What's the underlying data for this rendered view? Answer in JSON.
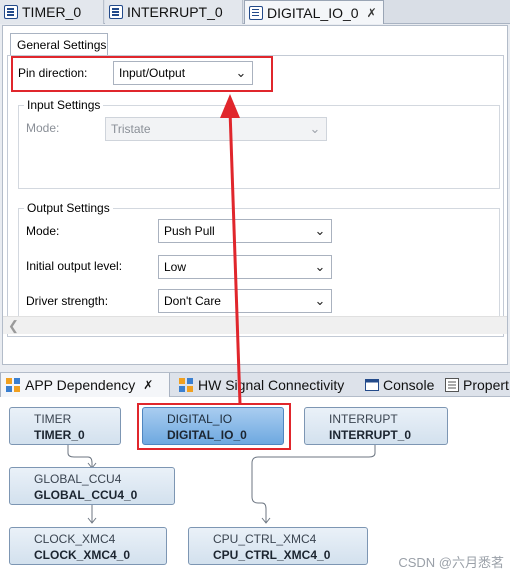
{
  "editor_tabs": [
    {
      "label": "TIMER_0"
    },
    {
      "label": "INTERRUPT_0"
    },
    {
      "label": "DIGITAL_IO_0",
      "close": "✗"
    }
  ],
  "general_settings_tab": "General Settings",
  "pin_direction": {
    "label": "Pin direction:",
    "value": "Input/Output"
  },
  "input_settings": {
    "title": "Input Settings",
    "mode_label": "Mode:",
    "mode_value": "Tristate"
  },
  "output_settings": {
    "title": "Output Settings",
    "mode_label": "Mode:",
    "mode_value": "Push Pull",
    "initial_level_label": "Initial output level:",
    "initial_level_value": "Low",
    "driver_strength_label": "Driver strength:",
    "driver_strength_value": "Don't Care"
  },
  "panel_tabs": [
    {
      "label": "APP Dependency",
      "close": "✗",
      "icon": "app-dependency-icon"
    },
    {
      "label": "HW Signal Connectivity",
      "icon": "hw-signal-icon"
    },
    {
      "label": "Console",
      "icon": "console-icon"
    },
    {
      "label": "Propert",
      "icon": "properties-icon"
    }
  ],
  "nodes": {
    "timer": {
      "type": "TIMER",
      "instance": "TIMER_0"
    },
    "digital_io": {
      "type": "DIGITAL_IO",
      "instance": "DIGITAL_IO_0"
    },
    "interrupt": {
      "type": "INTERRUPT",
      "instance": "INTERRUPT_0"
    },
    "global_ccu4": {
      "type": "GLOBAL_CCU4",
      "instance": "GLOBAL_CCU4_0"
    },
    "clock": {
      "type": "CLOCK_XMC4",
      "instance": "CLOCK_XMC4_0"
    },
    "cpu_ctrl": {
      "type": "CPU_CTRL_XMC4",
      "instance": "CPU_CTRL_XMC4_0"
    }
  },
  "watermark": "CSDN @六月悉茗",
  "colors": {
    "highlight_red": "#e0262c",
    "node_selected": "#6ea9e0",
    "node_default": "#d3e1ee"
  }
}
